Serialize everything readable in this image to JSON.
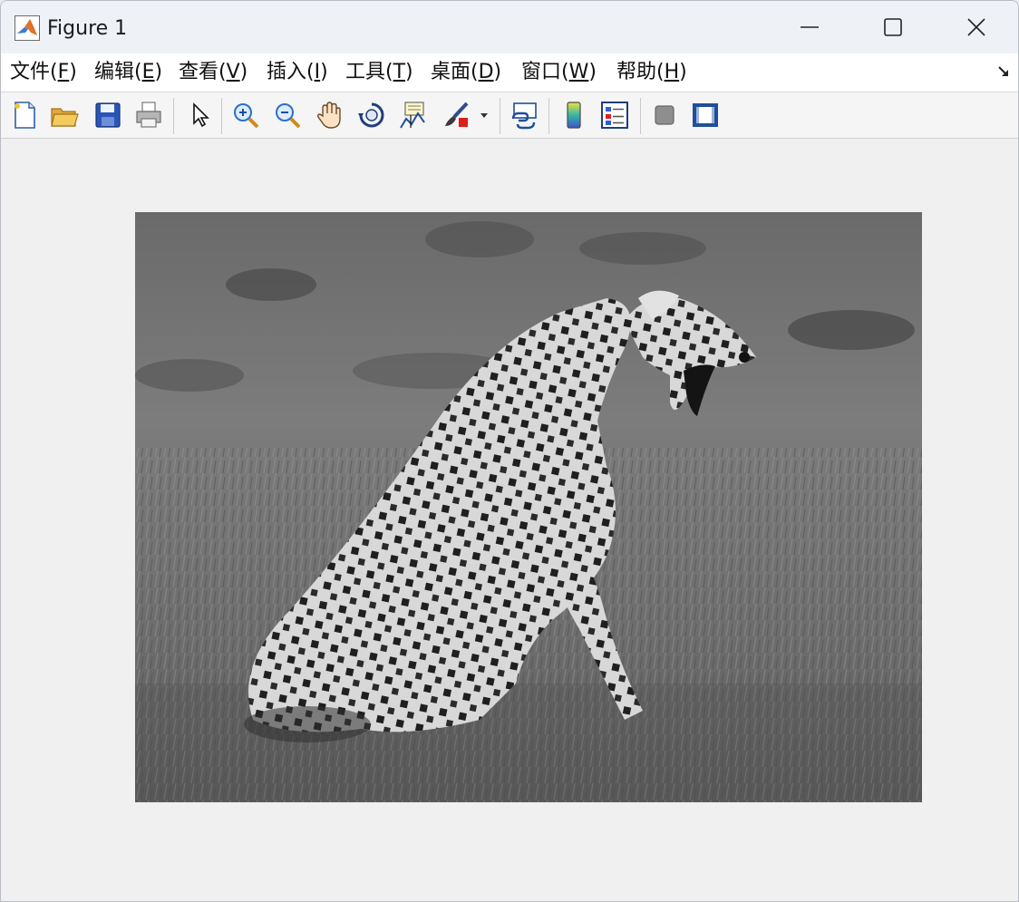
{
  "window": {
    "title": "Figure 1",
    "app_icon": "matlab-icon",
    "controls": [
      "minimize-icon",
      "maximize-icon",
      "close-icon"
    ]
  },
  "menu": {
    "items": [
      {
        "label": "文件(",
        "key": "F",
        "tail": ")"
      },
      {
        "label": "编辑(",
        "key": "E",
        "tail": ")"
      },
      {
        "label": "查看(",
        "key": "V",
        "tail": ")"
      },
      {
        "label": "插入(",
        "key": "I",
        "tail": ")"
      },
      {
        "label": "工具(",
        "key": "T",
        "tail": ")"
      },
      {
        "label": "桌面(",
        "key": "D",
        "tail": ")"
      },
      {
        "label": "窗口(",
        "key": "W",
        "tail": ")"
      },
      {
        "label": "帮助(",
        "key": "H",
        "tail": ")"
      }
    ],
    "dock_icon": "dock-arrow-icon"
  },
  "toolbar": {
    "icons": [
      "new-figure-icon",
      "open-file-icon",
      "save-icon",
      "print-icon",
      "select-arrow-icon",
      "zoom-in-icon",
      "zoom-out-icon",
      "pan-hand-icon",
      "rotate-3d-icon",
      "data-cursor-icon",
      "brush-icon",
      "brush-dropdown-icon",
      "link-plot-icon",
      "colorbar-icon",
      "legend-icon",
      "hide-plot-tools-icon",
      "show-plot-tools-icon"
    ]
  },
  "figure": {
    "image_description_icon": "grayscale-cheetah-image",
    "colors": {
      "background": "#f0f0f0",
      "titlebar": "#eef2f7",
      "menubar": "#ffffff"
    }
  }
}
